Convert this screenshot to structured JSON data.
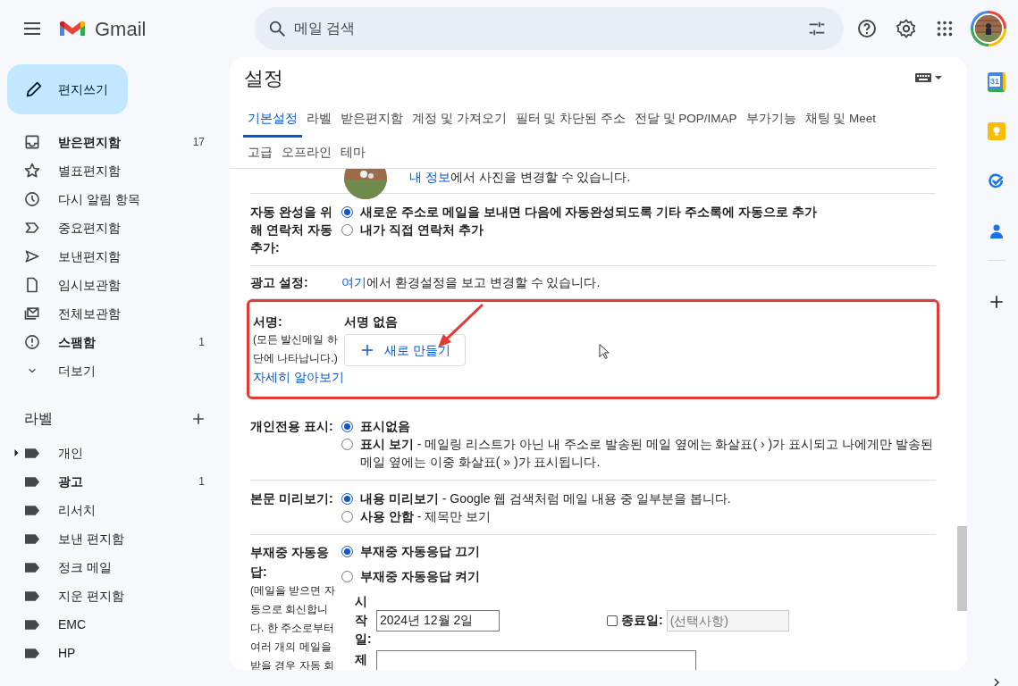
{
  "header": {
    "app_name": "Gmail",
    "search": {
      "placeholder": "메일 검색"
    }
  },
  "compose": "편지쓰기",
  "nav": [
    {
      "label": "받은편지함",
      "count": "17",
      "bold": true
    },
    {
      "label": "별표편지함",
      "bold": false
    },
    {
      "label": "다시 알림 항목",
      "bold": false
    },
    {
      "label": "중요편지함",
      "bold": false
    },
    {
      "label": "보낸편지함",
      "bold": false
    },
    {
      "label": "임시보관함",
      "bold": false
    },
    {
      "label": "전체보관함",
      "bold": false
    },
    {
      "label": "스팸함",
      "count": "1",
      "bold": true
    },
    {
      "label": "더보기",
      "bold": false
    }
  ],
  "labels": {
    "title": "라벨",
    "items": [
      {
        "label": "개인",
        "bold": false,
        "has_children": true
      },
      {
        "label": "광고",
        "count": "1",
        "bold": true,
        "has_children": false
      },
      {
        "label": "리서치",
        "bold": false,
        "has_children": false
      },
      {
        "label": "보낸 편지함",
        "bold": false,
        "has_children": false
      },
      {
        "label": "정크 메일",
        "bold": false,
        "has_children": false
      },
      {
        "label": "지운 편지함",
        "bold": false,
        "has_children": false
      },
      {
        "label": "EMC",
        "bold": false,
        "has_children": false
      },
      {
        "label": "HP",
        "bold": false,
        "has_children": false
      }
    ]
  },
  "settings": {
    "title": "설정",
    "tabs": [
      {
        "label": "기본설정",
        "selected": true
      },
      {
        "label": "라벨",
        "selected": false
      },
      {
        "label": "받은편지함",
        "selected": false
      },
      {
        "label": "계정 및 가져오기",
        "selected": false
      },
      {
        "label": "필터 및 차단된 주소",
        "selected": false
      },
      {
        "label": "전달 및 POP/IMAP",
        "selected": false
      },
      {
        "label": "부가기능",
        "selected": false
      },
      {
        "label": "채팅 및 Meet",
        "selected": false
      },
      {
        "label": "고급",
        "selected": false
      },
      {
        "label": "오프라인",
        "selected": false
      },
      {
        "label": "테마",
        "selected": false
      }
    ],
    "rows": [
      {
        "kind": "partial",
        "parts": [
          {
            "text": "내 정보",
            "link": true
          },
          {
            "text": "에서 사진을 변경할 수 있습니다.",
            "link": false
          }
        ]
      },
      {
        "kind": "radio",
        "label": "자동 완성을 위해 연락처 자동 추가:",
        "options": [
          {
            "title": "새로운 주소로 메일을 보내면 다음에 자동완성되도록 기타 주소록에 자동으로 추가",
            "selected": true
          },
          {
            "title": "내가 직접 연락처 추가",
            "selected": false
          }
        ]
      },
      {
        "kind": "text",
        "label": "광고 설정:",
        "parts": [
          {
            "text": "여기",
            "link": true
          },
          {
            "text": "에서 환경설정을 보고 변경할 수 있습니다.",
            "link": false
          }
        ]
      },
      {
        "kind": "signature",
        "label": "서명:",
        "note": "(모든 발신메일 하단에 나타납니다.)",
        "link": "자세히 알아보기",
        "value": "서명 없음",
        "button": "새로 만들기",
        "highlighted": true
      },
      {
        "kind": "radio",
        "label": "개인전용 표시:",
        "options": [
          {
            "title": "표시없음",
            "selected": true
          },
          {
            "title": "표시 보기",
            "desc": " - 메일링 리스트가 아닌 내 주소로 발송된 메일 옆에는 화살표( › )가 표시되고 나에게만 발송된 메일 옆에는 이중 화살표( » )가 표시됩니다.",
            "selected": false
          }
        ]
      },
      {
        "kind": "radio",
        "label": "본문 미리보기:",
        "options": [
          {
            "title": "내용 미리보기",
            "desc": " - Google 웹 검색처럼 메일 내용 중 일부분을 봅니다.",
            "selected": true
          },
          {
            "title": "사용 안함",
            "desc": " - 제목만 보기",
            "selected": false
          }
        ]
      },
      {
        "kind": "vacation",
        "label": "부재중 자동응답:",
        "note": "(메일을 받으면 자동으로 회신합니다. 한 주소로부터 여러 개의 메일을 받을 경우 자동 회",
        "options": [
          {
            "title": "부재중 자동응답 끄기",
            "selected": true
          },
          {
            "title": "부재중 자동응답 켜기",
            "selected": false
          }
        ],
        "start_label": "시작일:",
        "start_value": "2024년 12월 2일",
        "end_checked": false,
        "end_label": "종료일:",
        "end_placeholder": "(선택사항)",
        "subject_label": "제"
      }
    ]
  },
  "side_panel": {
    "calendar_date": "31"
  }
}
